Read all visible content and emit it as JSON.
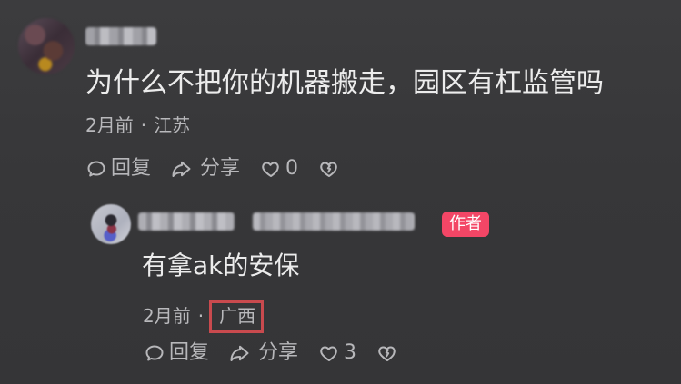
{
  "comment": {
    "text": "为什么不把你的机器搬走，园区有杠监管吗",
    "meta": {
      "time": "2月前",
      "separator": "·",
      "location": "江苏"
    },
    "actions": {
      "reply_label": "回复",
      "share_label": "分享",
      "like_count": "0"
    }
  },
  "reply": {
    "badge": "作者",
    "text": "有拿ak的安保",
    "meta": {
      "time": "2月前",
      "separator": "·",
      "location": "广西"
    },
    "actions": {
      "reply_label": "回复",
      "share_label": "分享",
      "like_count": "3"
    }
  },
  "colors": {
    "background": "#38383a",
    "primary_text": "#ececec",
    "secondary_text": "#b9b9bc",
    "badge_background": "#f34666",
    "location_highlight": "#c94a4e"
  },
  "icons": {
    "comment": "comment-icon",
    "share": "share-icon",
    "like": "heart-icon",
    "dislike": "broken-heart-icon"
  }
}
